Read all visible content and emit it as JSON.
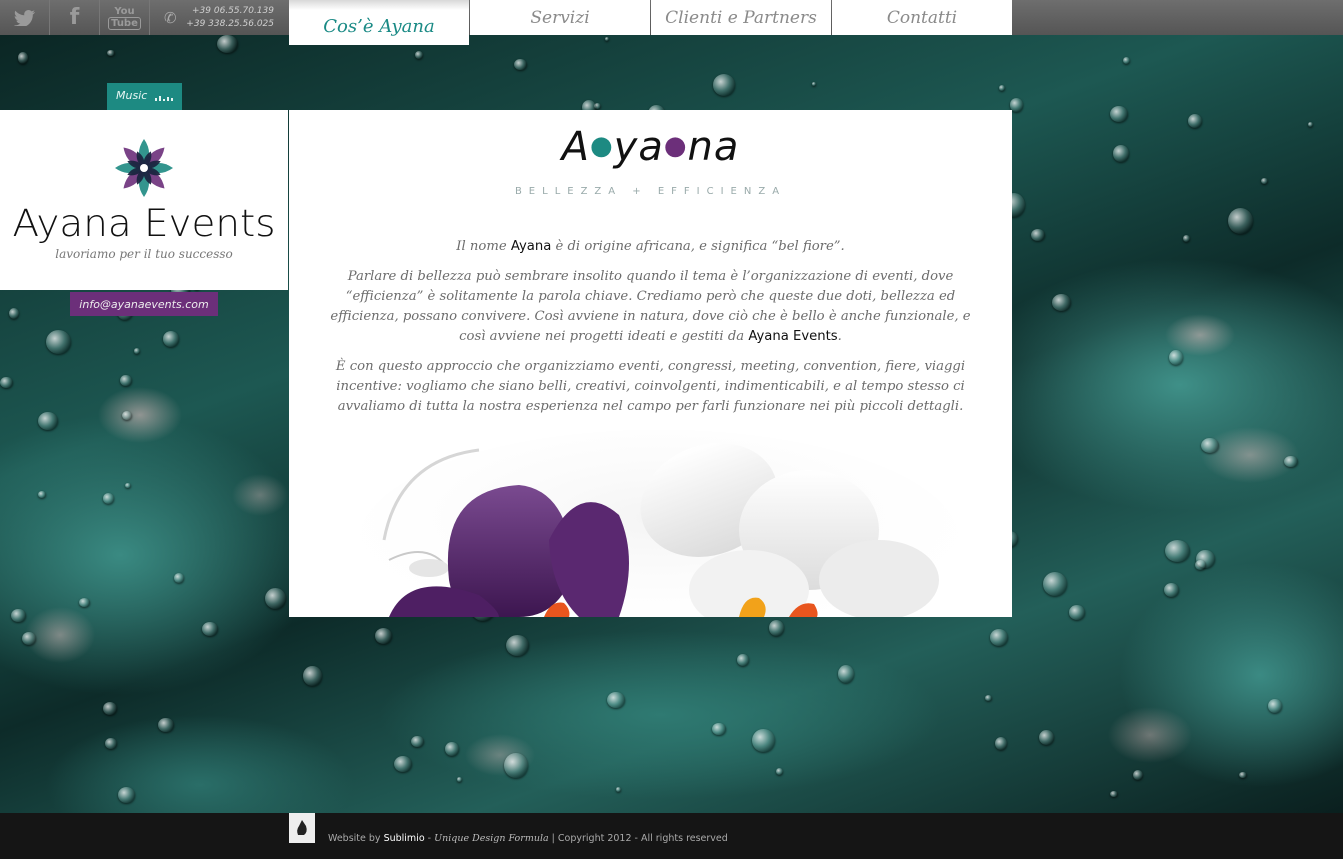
{
  "topbar": {
    "social": [
      {
        "name": "twitter",
        "icon": "twitter-bird-icon"
      },
      {
        "name": "facebook",
        "glyph": "f",
        "icon": "facebook-icon"
      },
      {
        "name": "youtube",
        "glyph_top": "You",
        "glyph_bottom": "Tube",
        "icon": "youtube-icon"
      }
    ],
    "phones": [
      "+39 06.55.70.139",
      "+39 338.25.56.025"
    ],
    "nav": [
      {
        "label": "Cos’è Ayana",
        "active": true
      },
      {
        "label": "Servizi",
        "active": false
      },
      {
        "label": "Clienti e Partners",
        "active": false
      },
      {
        "label": "Contatti",
        "active": false
      }
    ]
  },
  "music": {
    "label": "Music"
  },
  "logo": {
    "name": "Ayana Events",
    "tagline": "lavoriamo per il tuo successo",
    "colors": {
      "teal": "#1d8a82",
      "purple": "#6c2f7a",
      "navy": "#1b2540"
    }
  },
  "email": "info@ayanaevents.com",
  "content": {
    "brand": {
      "part1": "A",
      "part2": "ya",
      "part3": "na"
    },
    "slogan": "BELLEZZA + EFFICIENZA",
    "p1": {
      "a": "Il nome ",
      "b": "Ayana",
      "c": " è di origine africana, e significa “bel fiore”."
    },
    "p2": {
      "a": "Parlare di bellezza può sembrare insolito quando il tema è l’organizzazione di eventi, dove “efficienza” è solitamente la parola chiave. Crediamo però che queste due doti, bellezza ed efficienza, possano convivere. Così avviene in natura, dove ciò che è bello è anche funzionale, e così avviene nei progetti ideati e gestiti da ",
      "b": "Ayana Events",
      "c": "."
    },
    "p3": "È con questo approccio che organizziamo eventi, congressi, meeting, convention, fiere, viaggi incentive: vogliamo che siano belli, creativi, coinvolgenti, indimenticabili, e al tempo stesso ci avvaliamo di tutta la nostra esperienza nel campo per farli funzionare nei più piccoli dettagli."
  },
  "footer": {
    "prefix": "Website by ",
    "author": "Sublimio",
    "sep": " - ",
    "formula": "Unique Design Formula",
    "suffix": " | Copyright 2012 - All rights reserved"
  },
  "colors": {
    "accent_teal": "#1d8a82",
    "accent_purple": "#6c2f7a",
    "topbar": "#5f5f5f",
    "footer": "#151515"
  }
}
